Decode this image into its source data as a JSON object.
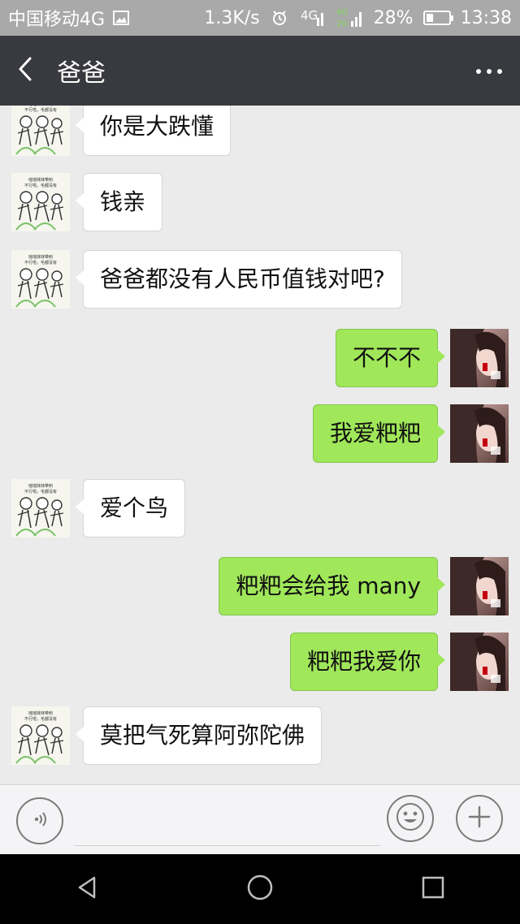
{
  "status_bar": {
    "carrier": "中国移动4G",
    "network_speed": "1.3K/s",
    "network_4g": "4G",
    "dual_network_top": "4G",
    "dual_network_bottom": "2G",
    "battery_percent": "28%",
    "battery_level": 0.28,
    "time": "13:38"
  },
  "header": {
    "title": "爸爸"
  },
  "messages": [
    {
      "side": "left",
      "text": "你是大跌懂"
    },
    {
      "side": "left",
      "text": "钱亲"
    },
    {
      "side": "left",
      "text": "爸爸都没有人民币值钱对吧?"
    },
    {
      "side": "right",
      "text": "不不不"
    },
    {
      "side": "right",
      "text": "我爱粑粑"
    },
    {
      "side": "left",
      "text": "爱个鸟"
    },
    {
      "side": "right",
      "text": "粑粑会给我 many"
    },
    {
      "side": "right",
      "text": "粑粑我爱你"
    },
    {
      "side": "left",
      "text": "莫把气死算阿弥陀佛"
    }
  ],
  "avatar_meme": {
    "line1": "瑶瑶妹妹带刺",
    "line2": "不行啦，毛都没有"
  },
  "input": {
    "placeholder": ""
  },
  "icons": {
    "back": "chevron-left-icon",
    "more": "more-dots-icon",
    "voice": "voice-icon",
    "emoji": "emoji-icon",
    "plus": "plus-icon",
    "nav_back": "triangle-back-icon",
    "nav_home": "circle-home-icon",
    "nav_recent": "square-recent-icon"
  },
  "colors": {
    "status_bar": "#a9a9a9",
    "title_bar": "#393a3f",
    "chat_bg": "#ebebeb",
    "bubble_left": "#ffffff",
    "bubble_right": "#a0e75a",
    "nav_bar": "#000000"
  }
}
